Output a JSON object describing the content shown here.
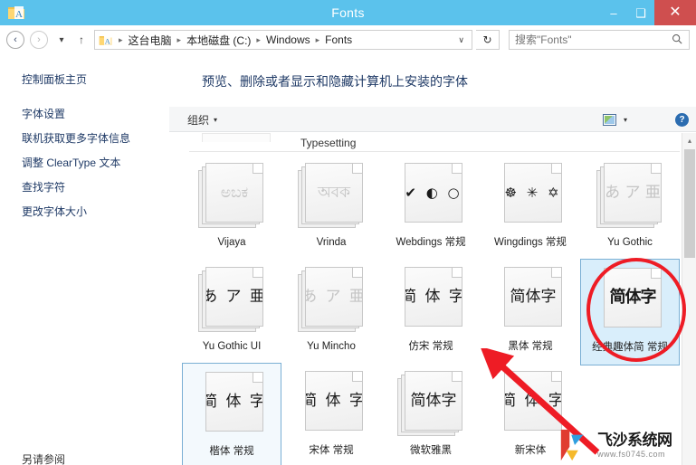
{
  "window": {
    "title": "Fonts",
    "app_icon": "fonts-folder-icon",
    "minimize_label": "–",
    "maximize_label": "❑",
    "close_label": "✕",
    "titlebar_color": "#5bc2ec",
    "close_color": "#cf4f4f"
  },
  "addressbar": {
    "back_label": "‹",
    "forward_label": "›",
    "recent_label": "▾",
    "up_label": "↑",
    "breadcrumbs": [
      "这台电脑",
      "本地磁盘 (C:)",
      "Windows",
      "Fonts"
    ],
    "separator": "▸",
    "dropdown_label": "∨",
    "refresh_label": "↻",
    "search_placeholder": "搜索\"Fonts\"",
    "search_value": "",
    "search_icon": "🔍"
  },
  "sidebar": {
    "home": "控制面板主页",
    "items": [
      "字体设置",
      "联机获取更多字体信息",
      "调整 ClearType 文本",
      "查找字符",
      "更改字体大小"
    ],
    "see_also": "另请参阅",
    "link_color": "#1f3a66"
  },
  "content": {
    "heading": "预览、删除或者显示和隐藏计算机上安装的字体",
    "toolbar": {
      "organize_label": "组织",
      "organize_caret": "▾",
      "view_icon": "view-options-icon",
      "view_caret": "▾",
      "help_label": "?"
    },
    "group_header": "Typesetting"
  },
  "fonts": {
    "rows": [
      [
        {
          "name": "Vijaya",
          "sample": "ಅಬಕ",
          "style": "faint",
          "stacked": true,
          "state": "normal"
        },
        {
          "name": "Vrinda",
          "sample": "অবক",
          "style": "faint",
          "stacked": true,
          "state": "normal"
        },
        {
          "name": "Webdings 常规",
          "sample": "✔ ◐ ○",
          "style": "sym",
          "stacked": false,
          "state": "normal"
        },
        {
          "name": "Wingdings 常规",
          "sample": "☸ ✳ ✡",
          "style": "sym",
          "stacked": false,
          "state": "normal"
        },
        {
          "name": "Yu Gothic",
          "sample": "あ ア 亜",
          "style": "faint",
          "stacked": true,
          "state": "normal"
        }
      ],
      [
        {
          "name": "Yu Gothic UI",
          "sample": "あ ア 亜",
          "style": "spaced",
          "stacked": true,
          "state": "normal"
        },
        {
          "name": "Yu Mincho",
          "sample": "あ ア 亜",
          "style": "faint",
          "stacked": true,
          "state": "normal"
        },
        {
          "name": "仿宋 常规",
          "sample": "简 体 字",
          "style": "spaced",
          "stacked": false,
          "state": "normal"
        },
        {
          "name": "黑体 常规",
          "sample": "简体字",
          "style": "normal",
          "stacked": false,
          "state": "normal"
        },
        {
          "name": "经典趣体简 常规",
          "sample": "简体字",
          "style": "round",
          "stacked": false,
          "state": "selected"
        }
      ],
      [
        {
          "name": "楷体 常规",
          "sample": "简 体 字",
          "style": "spaced",
          "stacked": false,
          "state": "hover"
        },
        {
          "name": "宋体 常规",
          "sample": "简 体 字",
          "style": "spaced",
          "stacked": false,
          "state": "normal"
        },
        {
          "name": "微软雅黑",
          "sample": "简体字",
          "style": "normal",
          "stacked": true,
          "state": "normal"
        },
        {
          "name": "新宋体",
          "sample": "简 体 字",
          "style": "spaced",
          "stacked": false,
          "state": "normal"
        }
      ]
    ]
  },
  "annotation": {
    "circle_color": "#ee1c25",
    "arrow_color": "#ee1c25",
    "target": "经典趣体简 常规"
  },
  "watermark": {
    "name": "飞沙系统网",
    "url": "www.fs0745.com"
  },
  "scrollbar": {
    "up_arrow": "▴"
  }
}
